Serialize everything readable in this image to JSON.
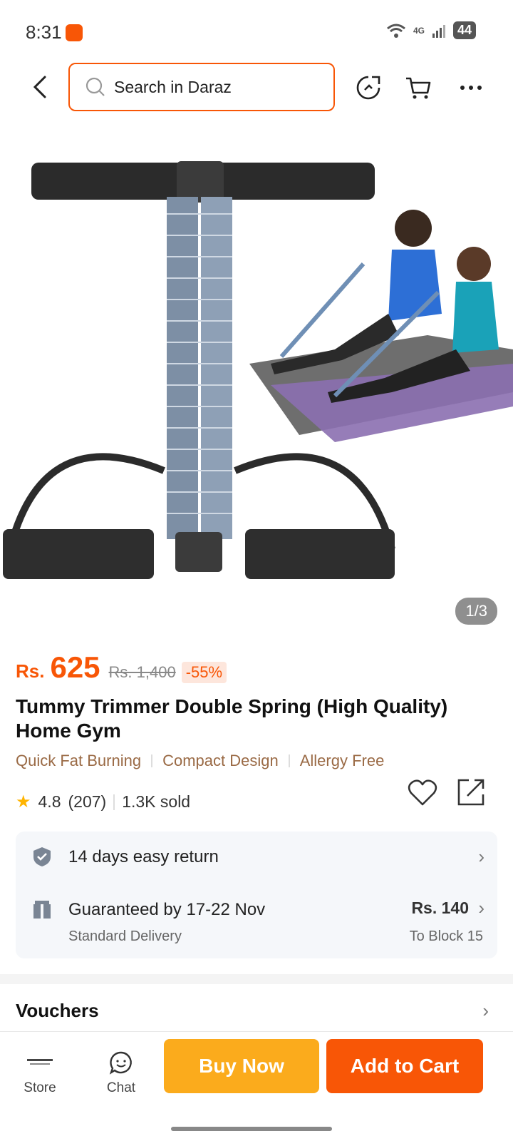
{
  "status_bar": {
    "time": "8:31",
    "network": "4G",
    "battery": "44"
  },
  "header": {
    "search_placeholder": "Search in Daraz",
    "icons": [
      "back-icon",
      "search-icon",
      "refresh-share-icon",
      "cart-icon",
      "more-icon"
    ]
  },
  "gallery": {
    "counter": "1/3"
  },
  "product": {
    "currency": "Rs.",
    "price": "625",
    "old_price": "Rs. 1,400",
    "discount": "-55%",
    "title": "Tummy Trimmer Double Spring (High Quality) Home Gym",
    "tags": [
      "Quick Fat Burning",
      "Compact Design",
      "Allergy Free"
    ],
    "rating": "4.8",
    "reviews": "(207)",
    "sold": "1.3K sold"
  },
  "service": {
    "return": "14 days easy return",
    "delivery": "Guaranteed by 17-22 Nov",
    "delivery_type": "Standard Delivery",
    "delivery_price": "Rs. 140",
    "delivery_to": "To Block 15"
  },
  "vouchers": {
    "title": "Vouchers"
  },
  "bottom_bar": {
    "store": "Store",
    "chat": "Chat",
    "buy_now": "Buy Now",
    "add_to_cart": "Add to Cart"
  },
  "colors": {
    "accent": "#f85606",
    "buy": "#fbab1c",
    "tag": "#9a6a45"
  }
}
